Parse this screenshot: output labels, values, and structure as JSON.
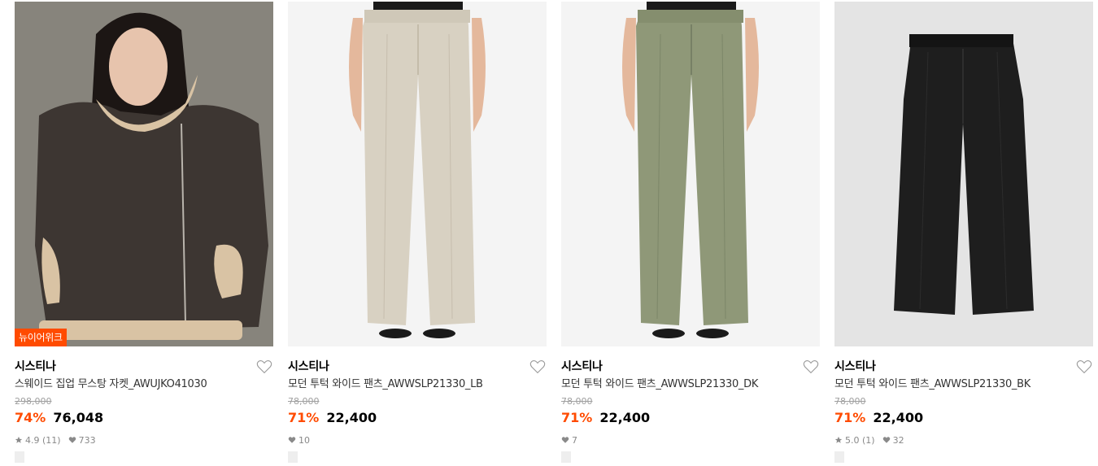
{
  "products": [
    {
      "badge": "뉴이어위크",
      "brand": "시스티나",
      "name": "스웨이드 집업 무스탕 자켓_AWUJKO41030",
      "original_price": "298,000",
      "discount": "74%",
      "price": "76,048",
      "rating": "4.9",
      "review_count": "(11)",
      "likes": "733",
      "image_icon": "jacket-photo",
      "colors": {
        "garment": "#3d3632",
        "background": "#8e8a82"
      }
    },
    {
      "badge": "",
      "brand": "시스티나",
      "name": "모던 투턱 와이드 팬츠_AWWSLP21330_LB",
      "original_price": "78,000",
      "discount": "71%",
      "price": "22,400",
      "rating": "",
      "review_count": "",
      "likes": "10",
      "image_icon": "pants-photo",
      "colors": {
        "garment": "#d8d1c2",
        "background": "#f4f4f4"
      }
    },
    {
      "badge": "",
      "brand": "시스티나",
      "name": "모던 투턱 와이드 팬츠_AWWSLP21330_DK",
      "original_price": "78,000",
      "discount": "71%",
      "price": "22,400",
      "rating": "",
      "review_count": "",
      "likes": "7",
      "image_icon": "pants-photo",
      "colors": {
        "garment": "#8f9878",
        "background": "#f4f4f4"
      }
    },
    {
      "badge": "",
      "brand": "시스티나",
      "name": "모던 투턱 와이드 팬츠_AWWSLP21330_BK",
      "original_price": "78,000",
      "discount": "71%",
      "price": "22,400",
      "rating": "5.0",
      "review_count": "(1)",
      "likes": "32",
      "image_icon": "pants-flatlay-photo",
      "colors": {
        "garment": "#1e1e1e",
        "background": "#e4e4e4"
      }
    }
  ],
  "accent_color": "#ff4b00"
}
